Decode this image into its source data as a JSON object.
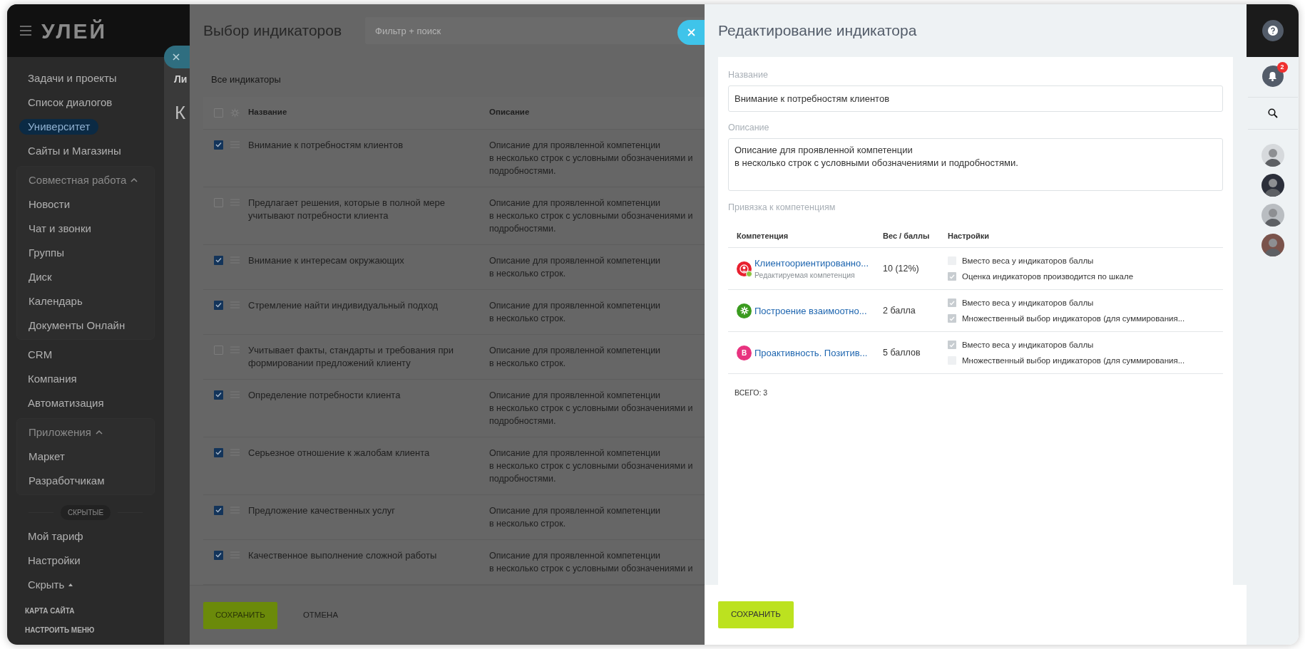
{
  "sidebar": {
    "logo": "УЛЕЙ",
    "items": [
      {
        "label": "Задачи и проекты",
        "selected": false
      },
      {
        "label": "Список диалогов",
        "selected": false
      },
      {
        "label": "Университет",
        "selected": true
      },
      {
        "label": "Сайты и Магазины",
        "selected": false
      },
      {
        "label": "Совместная работа",
        "expanded": true,
        "children": [
          {
            "label": "Новости",
            "selected": false
          },
          {
            "label": "Чат и звонки",
            "selected": false
          },
          {
            "label": "Группы",
            "selected": false
          },
          {
            "label": "Диск",
            "selected": false
          },
          {
            "label": "Календарь",
            "selected": false
          },
          {
            "label": "Документы Онлайн",
            "selected": false
          }
        ]
      },
      {
        "label": "CRM",
        "selected": false
      },
      {
        "label": "Компания",
        "selected": false
      },
      {
        "label": "Автоматизация",
        "selected": false
      },
      {
        "label": "Приложения",
        "expanded": true,
        "children": [
          {
            "label": "Маркет",
            "selected": false
          },
          {
            "label": "Разработчикам",
            "selected": false
          }
        ]
      }
    ],
    "hidden_label": "СКРЫТЫЕ",
    "hidden_items": [
      {
        "label": "Мой тариф",
        "selected": false
      },
      {
        "label": "Настройки",
        "selected": false
      },
      {
        "label": "Скрыть",
        "selected": false,
        "caret": true
      }
    ],
    "footer_links": [
      "КАРТА САЙТА",
      "НАСТРОИТЬ МЕНЮ"
    ]
  },
  "background_page": {
    "tab_fragment": "Ли",
    "heading_fragment": "К"
  },
  "indicator_picker": {
    "title": "Выбор индикаторов",
    "search": {
      "placeholder": "Фильтр + поиск"
    },
    "section_label": "Все индикаторы",
    "columns": [
      "Название",
      "Описание"
    ],
    "header_checked": false,
    "rows": [
      {
        "checked": true,
        "name": "Внимание к потребностям клиентов",
        "description": [
          "Описание для проявленной компетенции",
          "в несколько строк с условными обозначениями и",
          "подробностями."
        ]
      },
      {
        "checked": false,
        "name": "Предлагает решения, которые в полной мере учитывают потребности клиента",
        "description": [
          "Описание для проявленной компетенции",
          "в несколько строк с условными обозначениями и",
          "подробностями."
        ]
      },
      {
        "checked": true,
        "name": "Внимание к интересам окружающих",
        "description": [
          "Описание для проявленной компетенции",
          "в несколько строк."
        ]
      },
      {
        "checked": true,
        "name": "Стремление найти индивидуальный подход",
        "description": [
          "Описание для проявленной компетенции",
          "в несколько строк."
        ]
      },
      {
        "checked": false,
        "name": "Учитывает факты, стандарты и требования при формировании предложений клиенту",
        "description": [
          "Описание для проявленной компетенции",
          "в несколько строк."
        ]
      },
      {
        "checked": true,
        "name": "Определение потребности клиента",
        "description": [
          "Описание для проявленной компетенции",
          "в несколько строк с условными обозначениями и",
          "подробностями."
        ]
      },
      {
        "checked": true,
        "name": "Серьезное отношение к жалобам клиента",
        "description": [
          "Описание для проявленной компетенции",
          "в несколько строк с условными обозначениями и",
          "подробностями."
        ]
      },
      {
        "checked": true,
        "name": "Предложение качественных услуг",
        "description": [
          "Описание для проявленной компетенции",
          "в несколько строк."
        ]
      },
      {
        "checked": true,
        "name": "Качественное выполнение сложной работы",
        "description": [
          "Описание для проявленной компетенции",
          "в несколько строк с условными обозначениями и"
        ]
      }
    ],
    "buttons": [
      {
        "label": "СОХРАНИТЬ",
        "kind": "primary"
      },
      {
        "label": "ОТМЕНА",
        "kind": "link"
      }
    ]
  },
  "indicator_editor": {
    "title": "Редактирование индикатора",
    "name_field": {
      "label": "Название",
      "value": "Внимание к потребностям клиентов"
    },
    "description_field": {
      "label": "Описание",
      "value": "Описание для проявленной компетенции\nв несколько строк с условными обозначениями и подробностями."
    },
    "binding_label": "Привязка к компетенциям",
    "columns": [
      "Компетенция",
      "Вес / баллы",
      "Настройки"
    ],
    "competencies": [
      {
        "kind": "person",
        "color": "#e8202f",
        "name": "Клиентоориентированно...",
        "subtitle": "Редактируемая компетенция",
        "weight": "10 (12%)",
        "options": [
          {
            "label": "Вместо веса у индикаторов баллы",
            "checked": false
          },
          {
            "label": "Оценка индикаторов производится по шкале",
            "checked": true
          }
        ]
      },
      {
        "kind": "gear",
        "color": "#3a9b1f",
        "name": "Построение взаимоотно...",
        "weight": "2 балла",
        "options": [
          {
            "label": "Вместо веса у индикаторов баллы",
            "checked": true
          },
          {
            "label": "Множественный выбор индикаторов (для суммирования...",
            "checked": true
          }
        ]
      },
      {
        "kind": "letter",
        "letter": "В",
        "color": "#e8337f",
        "name": "Проактивность. Позитив...",
        "weight": "5 баллов",
        "options": [
          {
            "label": "Вместо веса у индикаторов баллы",
            "checked": true
          },
          {
            "label": "Множественный выбор индикаторов (для суммирования...",
            "checked": false
          }
        ]
      }
    ],
    "total": "ВСЕГО: 3",
    "save_button": "СОХРАНИТЬ"
  },
  "right_rail": {
    "notifications_badge": "2",
    "avatars": [
      {
        "color": "#d6d9dc"
      },
      {
        "color": "#2b2f3a"
      },
      {
        "color": "#b9bdc1"
      },
      {
        "color": "#7a534b"
      }
    ]
  }
}
